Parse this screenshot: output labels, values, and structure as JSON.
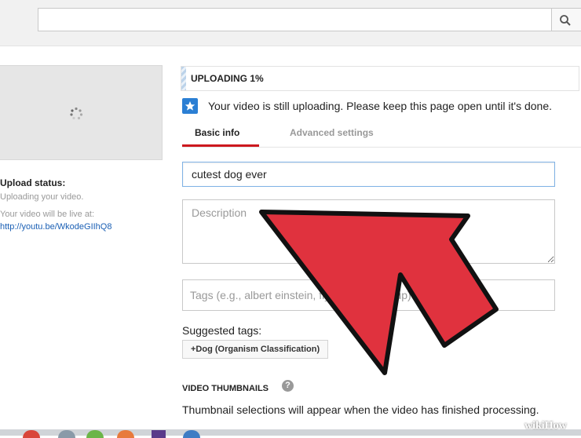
{
  "search": {
    "value": "",
    "placeholder": ""
  },
  "upload": {
    "progress_label": "UPLOADING 1%",
    "progress_percent": 1,
    "notice": "Your video is still uploading. Please keep this page open until it's done."
  },
  "status": {
    "label": "Upload status:",
    "text": "Uploading your video.",
    "live_at": "Your video will be live at:",
    "link": "http://youtu.be/WkodeGIIhQ8"
  },
  "tabs": [
    {
      "label": "Basic info",
      "active": true
    },
    {
      "label": "Advanced settings",
      "active": false
    }
  ],
  "form": {
    "title_value": "cutest dog ever",
    "description_placeholder": "Description",
    "tags_placeholder": "Tags (e.g., albert einstein, flying pig, mashup)",
    "suggested_tags_label": "Suggested tags:",
    "suggested_tags": [
      "+Dog (Organism Classification)"
    ]
  },
  "thumbnails": {
    "heading": "VIDEO THUMBNAILS",
    "help": "?",
    "text": "Thumbnail selections will appear when the video has finished processing."
  },
  "watermark": {
    "wiki": "wiki",
    "how": "How"
  },
  "colors": {
    "tab_active_underline": "#cc181e",
    "info_icon": "#2b7fd4",
    "arrow_fill": "#e0323e",
    "link": "#1a5fb4"
  },
  "icons": {
    "search": "search-icon",
    "spinner": "spinner-icon",
    "info": "star-info-icon",
    "help": "help-icon"
  }
}
